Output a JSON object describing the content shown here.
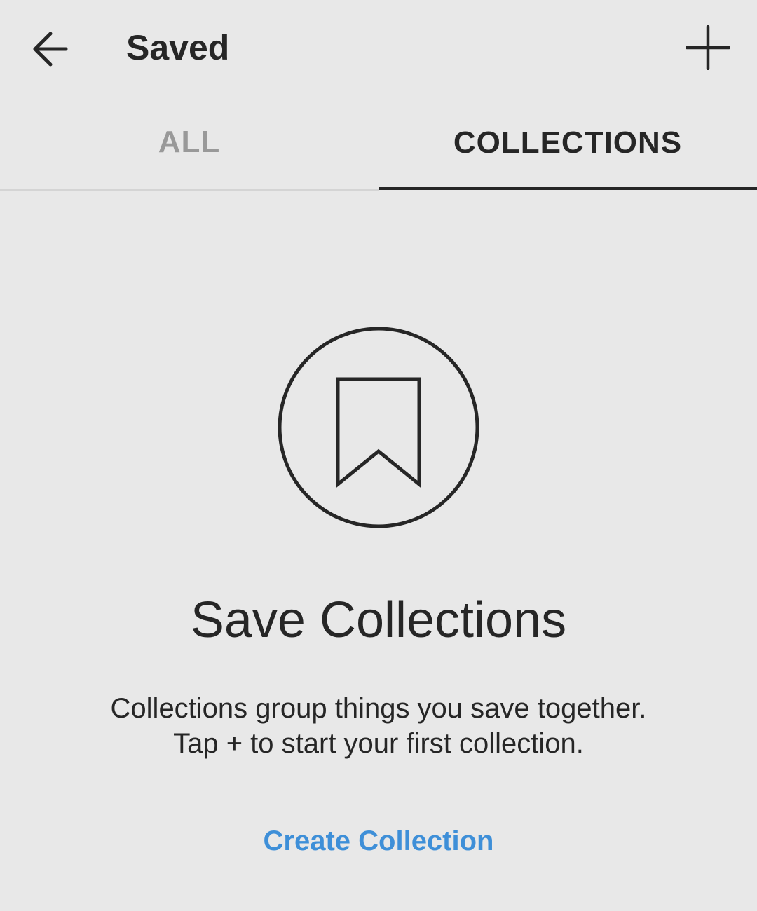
{
  "header": {
    "title": "Saved",
    "back_icon": "arrow-left-icon",
    "add_icon": "plus-icon"
  },
  "tabs": [
    {
      "label": "ALL",
      "active": false
    },
    {
      "label": "COLLECTIONS",
      "active": true
    }
  ],
  "empty_state": {
    "icon": "bookmark-icon",
    "title": "Save Collections",
    "description_line1": "Collections group things you save together.",
    "description_line2": "Tap + to start your first collection.",
    "action_label": "Create Collection"
  },
  "colors": {
    "background": "#e8e8e8",
    "text": "#262626",
    "inactive_tab": "#999999",
    "link": "#3e8fd8"
  }
}
